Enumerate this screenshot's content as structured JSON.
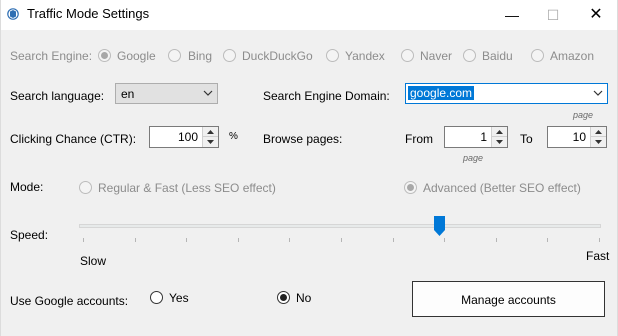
{
  "window": {
    "title": "Traffic Mode Settings",
    "minimize": "—",
    "maximize": "☐",
    "close": "✕"
  },
  "search_engine": {
    "label": "Search Engine:",
    "options": [
      "Google",
      "Bing",
      "DuckDuckGo",
      "Yandex",
      "Naver",
      "Baidu",
      "Amazon"
    ],
    "selected": "Google"
  },
  "search_language": {
    "label": "Search language:",
    "value": "en"
  },
  "search_engine_domain": {
    "label": "Search Engine Domain:",
    "value": "google.com",
    "caption": "page"
  },
  "ctr": {
    "label": "Clicking Chance (CTR):",
    "value": "100",
    "unit": "%"
  },
  "browse_pages": {
    "label": "Browse pages:",
    "from_label": "From",
    "from_value": "1",
    "to_label": "To",
    "to_value": "10",
    "caption": "page"
  },
  "mode": {
    "label": "Mode:",
    "option_regular": "Regular & Fast (Less SEO effect)",
    "option_advanced": "Advanced (Better SEO effect)",
    "selected": "Advanced (Better SEO effect)"
  },
  "speed": {
    "label": "Speed:",
    "min_label": "Slow",
    "max_label": "Fast",
    "level": 0.69
  },
  "google_accounts": {
    "label": "Use Google accounts:",
    "yes": "Yes",
    "no": "No",
    "selected": "No"
  },
  "manage_accounts": {
    "label": "Manage accounts"
  },
  "colors": {
    "accent": "#0078d7",
    "disabled_text": "#8c8c8c",
    "window_bg": "#f0f0f0"
  }
}
